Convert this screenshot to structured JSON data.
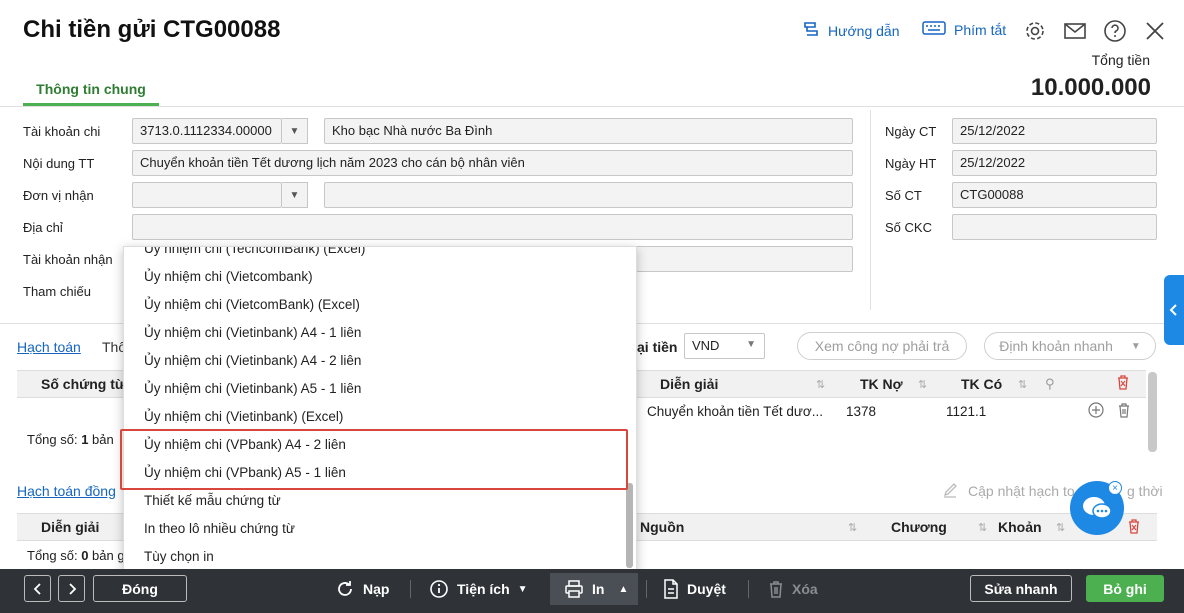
{
  "header": {
    "title": "Chi tiền gửi CTG00088",
    "help_label": "Hướng dẫn",
    "shortcut_label": "Phím tắt",
    "total_label": "Tổng tiền",
    "total_value": "10.000.000"
  },
  "tabs": {
    "general": "Thông tin chung"
  },
  "form": {
    "tk_chi_label": "Tài khoản chi",
    "tk_chi_value": "3713.0.1112334.00000",
    "tk_chi_name": "Kho bạc Nhà nước Ba Đình",
    "noi_dung_label": "Nội dung TT",
    "noi_dung_value": "Chuyển khoản tiền Tết dương lịch năm 2023 cho cán bộ nhân viên",
    "don_vi_label": "Đơn vị nhận",
    "dia_chi_label": "Địa chỉ",
    "tk_nhan_label": "Tài khoản nhận",
    "tham_chieu_label": "Tham chiếu",
    "ngay_ct_label": "Ngày CT",
    "ngay_ct_value": "25/12/2022",
    "ngay_ht_label": "Ngày HT",
    "ngay_ht_value": "25/12/2022",
    "so_ct_label": "Số CT",
    "so_ct_value": "CTG00088",
    "so_ckc_label": "Số CKC"
  },
  "section1": {
    "tab1": "Hạch toán",
    "tab2": "Thô",
    "currency_label": "ại tiền",
    "currency_value": "VND",
    "btn_debt": "Xem công nợ phải trả",
    "btn_quick": "Định khoản nhanh",
    "columns": [
      "Số chứng từ",
      "Diễn giải",
      "TK Nợ",
      "TK Có"
    ],
    "row": {
      "dien_giai": "Chuyển khoản tiền Tết dươ...",
      "tk_no": "1378",
      "tk_co": "1121.1"
    },
    "total_prefix": "Tổng số: ",
    "total_count": "1",
    "total_suffix": " bản"
  },
  "section2": {
    "tab1": "Hạch toán đồng",
    "update_label": "Cập nhật hạch to",
    "update_suffix": "g thời",
    "columns": [
      "Diễn giải",
      "Nguồn",
      "Chương",
      "Khoản"
    ],
    "total_prefix": "Tổng số: ",
    "total_count": "0",
    "total_suffix": " bản g"
  },
  "print_menu": {
    "items": [
      "Ủy nhiệm chi (TechcomBank) (Excel)",
      "Ủy nhiệm chi (Vietcombank)",
      "Ủy nhiệm chi (VietcomBank) (Excel)",
      "Ủy nhiệm chi (Vietinbank) A4 - 1 liên",
      "Ủy nhiệm chi (Vietinbank) A4 - 2 liên",
      "Ủy nhiệm chi (Vietinbank) A5 - 1 liên",
      "Ủy nhiệm chi (Vietinbank) (Excel)",
      "Ủy nhiệm chi (VPbank) A4 - 2 liên",
      "Ủy nhiệm chi (VPbank) A5 - 1 liên",
      "Thiết kế mẫu chứng từ",
      "In theo lô nhiều chứng từ",
      "Tùy chọn in"
    ]
  },
  "footer": {
    "close": "Đóng",
    "load": "Nạp",
    "utility": "Tiện ích",
    "print": "In",
    "approve": "Duyệt",
    "delete": "Xóa",
    "quick_edit": "Sửa nhanh",
    "save": "Bỏ ghi"
  },
  "colors": {
    "accent_green": "#2e7d32",
    "link_blue": "#1565c0",
    "highlight_red": "#d9463d",
    "footer_bg": "#2f3337",
    "save_green": "#4caf50"
  }
}
